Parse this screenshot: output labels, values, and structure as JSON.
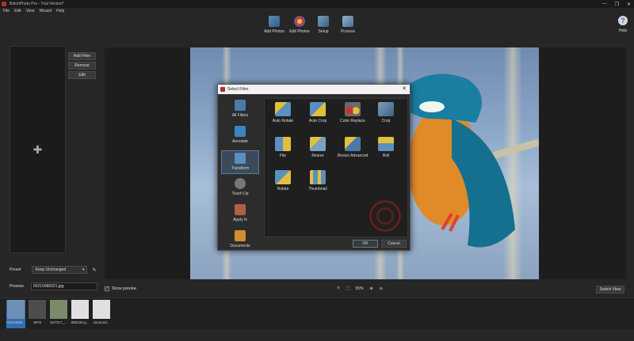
{
  "window": {
    "title": "BatchPhoto Pro - Trial Version*",
    "controls": [
      "—",
      "❐",
      "✕"
    ]
  },
  "menu": [
    "File",
    "Edit",
    "View",
    "Wizard",
    "Help"
  ],
  "toolbar": {
    "add_photos": "Add Photos",
    "edit_photos": "Edit Photos",
    "setup": "Setup",
    "process": "Process",
    "help": "Help"
  },
  "side_buttons": {
    "add_filter": "Add Filter",
    "remove": "Remove",
    "edit": "Edit"
  },
  "preset": {
    "label": "Preset",
    "value": "Keep Unchanged"
  },
  "preview": {
    "label": "Preview",
    "file": "00210088321.jpg"
  },
  "show_preview": {
    "label": "Show preview",
    "checked": true
  },
  "zoom": {
    "level": "55%"
  },
  "switch_view": "Switch View",
  "dialog": {
    "title": "Select Filter",
    "categories": [
      {
        "label": "All Filters",
        "icon": "all-filters-icon",
        "color": "#4a7aa8"
      },
      {
        "label": "Annotate",
        "icon": "annotate-icon",
        "color": "#3d83c4"
      },
      {
        "label": "Transform",
        "icon": "transform-icon",
        "color": "#5a8fbf"
      },
      {
        "label": "Touch Up",
        "icon": "touch-up-icon",
        "color": "#777777"
      },
      {
        "label": "Apply fx",
        "icon": "apply-fx-icon",
        "color": "#b06040"
      },
      {
        "label": "Documents",
        "icon": "documents-icon",
        "color": "#d09030"
      }
    ],
    "selected_category": 2,
    "filters": [
      {
        "label": "Auto Rotate",
        "icon": "auto-rotate-icon"
      },
      {
        "label": "Auto Crop",
        "icon": "auto-crop-icon"
      },
      {
        "label": "Color Replace",
        "icon": "color-replace-icon"
      },
      {
        "label": "Crop",
        "icon": "crop-icon"
      },
      {
        "label": "Flip",
        "icon": "flip-icon"
      },
      {
        "label": "Resize",
        "icon": "resize-icon"
      },
      {
        "label": "Resize Advanced",
        "icon": "resize-advanced-icon"
      },
      {
        "label": "Roll",
        "icon": "roll-icon"
      },
      {
        "label": "Rotate",
        "icon": "rotate-icon"
      },
      {
        "label": "Thumbnail",
        "icon": "thumbnail-icon"
      }
    ],
    "ok": "OK",
    "cancel": "Cancel"
  },
  "thumbnails": [
    {
      "label": "00210088...",
      "selected": true,
      "color": "#6f8fb5"
    },
    {
      "label": "3676",
      "selected": false,
      "color": "#4d4d4d"
    },
    {
      "label": "527317_...",
      "selected": false,
      "color": "#7c8a6a"
    },
    {
      "label": "890233-g...",
      "selected": false,
      "color": "#e0e0e0"
    },
    {
      "label": "simonod...",
      "selected": false,
      "color": "#e0e0e0"
    }
  ]
}
